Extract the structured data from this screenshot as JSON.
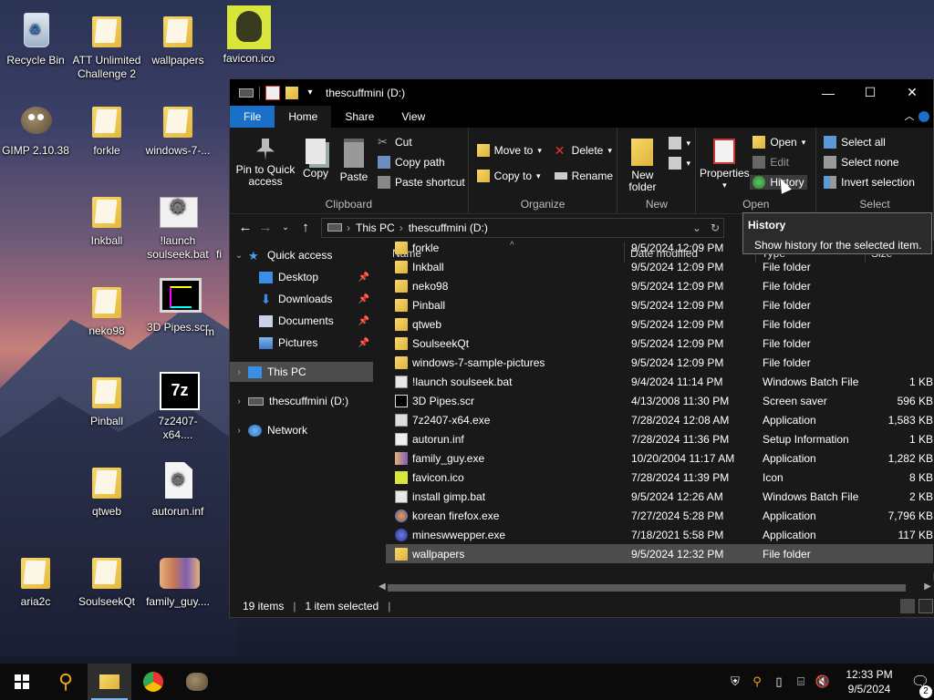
{
  "desktop": {
    "icons": [
      {
        "label": "Recycle Bin",
        "icon": "recycle-bin-icon"
      },
      {
        "label": "ATT Unlimited Challenge 2",
        "icon": "folder-icon"
      },
      {
        "label": "wallpapers",
        "icon": "folder-icon"
      },
      {
        "label": "favicon.ico",
        "icon": "image-icon"
      },
      {
        "label": "GIMP 2.10.38",
        "icon": "gimp-icon"
      },
      {
        "label": "forkle",
        "icon": "folder-icon"
      },
      {
        "label": "windows-7-...",
        "icon": "folder-icon"
      },
      {
        "label": "Inkball",
        "icon": "folder-icon"
      },
      {
        "label": "!launch soulseek.bat",
        "icon": "batch-file-icon"
      },
      {
        "label": "neko98",
        "icon": "folder-icon"
      },
      {
        "label": "3D Pipes.scr",
        "icon": "screensaver-icon"
      },
      {
        "label": "Pinball",
        "icon": "folder-icon"
      },
      {
        "label": "7z2407-x64....",
        "icon": "7zip-icon"
      },
      {
        "label": "qtweb",
        "icon": "folder-icon"
      },
      {
        "label": "autorun.inf",
        "icon": "inf-file-icon"
      },
      {
        "label": "aria2c",
        "icon": "folder-icon"
      },
      {
        "label": "SoulseekQt",
        "icon": "folder-icon"
      },
      {
        "label": "family_guy....",
        "icon": "app-icon"
      }
    ],
    "partial_labels": [
      "m",
      "fi"
    ]
  },
  "window": {
    "title": "thescuffmini (D:)",
    "controls": {
      "minimize": "—",
      "maximize": "☐",
      "close": "✕"
    },
    "tabs": [
      {
        "label": "File"
      },
      {
        "label": "Home"
      },
      {
        "label": "Share"
      },
      {
        "label": "View"
      }
    ],
    "ribbon": {
      "clipboard": {
        "label": "Clipboard",
        "pin": "Pin to Quick access",
        "copy": "Copy",
        "paste": "Paste",
        "cut": "Cut",
        "copy_path": "Copy path",
        "paste_shortcut": "Paste shortcut"
      },
      "organize": {
        "label": "Organize",
        "move_to": "Move to",
        "copy_to": "Copy to",
        "delete": "Delete",
        "rename": "Rename"
      },
      "new": {
        "label": "New",
        "new_folder": "New folder"
      },
      "open": {
        "label": "Open",
        "properties": "Properties",
        "open": "Open",
        "edit": "Edit",
        "history": "History"
      },
      "select": {
        "label": "Select",
        "select_all": "Select all",
        "select_none": "Select none",
        "invert": "Invert selection"
      }
    },
    "address": {
      "crumbs": [
        "This PC",
        "thescuffmini (D:)"
      ]
    },
    "nav_pane": [
      {
        "label": "Quick access",
        "icon": "star-icon",
        "chev": "⌄",
        "pinned": false
      },
      {
        "label": "Desktop",
        "icon": "desktop-icon",
        "chev": "",
        "pinned": true
      },
      {
        "label": "Downloads",
        "icon": "download-icon",
        "chev": "",
        "pinned": true
      },
      {
        "label": "Documents",
        "icon": "documents-icon",
        "chev": "",
        "pinned": true
      },
      {
        "label": "Pictures",
        "icon": "pictures-icon",
        "chev": "",
        "pinned": true
      },
      {
        "label": "This PC",
        "icon": "computer-icon",
        "chev": "›",
        "pinned": false
      },
      {
        "label": "thescuffmini (D:)",
        "icon": "drive-icon",
        "chev": "›",
        "pinned": false
      },
      {
        "label": "Network",
        "icon": "network-icon",
        "chev": "›",
        "pinned": false
      }
    ],
    "columns": {
      "name": "Name",
      "date": "Date modified",
      "type": "Type",
      "size": "Size"
    },
    "files": [
      {
        "name": "forkle",
        "date": "9/5/2024 12:09 PM",
        "type": "File folder",
        "size": "",
        "kind": "folder"
      },
      {
        "name": "Inkball",
        "date": "9/5/2024 12:09 PM",
        "type": "File folder",
        "size": "",
        "kind": "folder"
      },
      {
        "name": "neko98",
        "date": "9/5/2024 12:09 PM",
        "type": "File folder",
        "size": "",
        "kind": "folder"
      },
      {
        "name": "Pinball",
        "date": "9/5/2024 12:09 PM",
        "type": "File folder",
        "size": "",
        "kind": "folder"
      },
      {
        "name": "qtweb",
        "date": "9/5/2024 12:09 PM",
        "type": "File folder",
        "size": "",
        "kind": "folder"
      },
      {
        "name": "SoulseekQt",
        "date": "9/5/2024 12:09 PM",
        "type": "File folder",
        "size": "",
        "kind": "folder"
      },
      {
        "name": "windows-7-sample-pictures",
        "date": "9/5/2024 12:09 PM",
        "type": "File folder",
        "size": "",
        "kind": "folder"
      },
      {
        "name": "!launch soulseek.bat",
        "date": "9/4/2024 11:14 PM",
        "type": "Windows Batch File",
        "size": "1 KB",
        "kind": "bat"
      },
      {
        "name": "3D Pipes.scr",
        "date": "4/13/2008 11:30 PM",
        "type": "Screen saver",
        "size": "596 KB",
        "kind": "scr"
      },
      {
        "name": "7z2407-x64.exe",
        "date": "7/28/2024 12:08 AM",
        "type": "Application",
        "size": "1,583 KB",
        "kind": "exe"
      },
      {
        "name": "autorun.inf",
        "date": "7/28/2024 11:36 PM",
        "type": "Setup Information",
        "size": "1 KB",
        "kind": "inf"
      },
      {
        "name": "family_guy.exe",
        "date": "10/20/2004 11:17 AM",
        "type": "Application",
        "size": "1,282 KB",
        "kind": "family"
      },
      {
        "name": "favicon.ico",
        "date": "7/28/2024 11:39 PM",
        "type": "Icon",
        "size": "8 KB",
        "kind": "ico"
      },
      {
        "name": "install gimp.bat",
        "date": "9/5/2024 12:26 AM",
        "type": "Windows Batch File",
        "size": "2 KB",
        "kind": "bat"
      },
      {
        "name": "korean firefox.exe",
        "date": "7/27/2024 5:28 PM",
        "type": "Application",
        "size": "7,796 KB",
        "kind": "fox"
      },
      {
        "name": "mineswwepper.exe",
        "date": "7/18/2021 5:58 PM",
        "type": "Application",
        "size": "117 KB",
        "kind": "globe"
      },
      {
        "name": "wallpapers",
        "date": "9/5/2024 12:32 PM",
        "type": "File folder",
        "size": "",
        "kind": "folder",
        "selected": true
      }
    ],
    "status": {
      "items": "19 items",
      "selected": "1 item selected"
    },
    "tooltip": {
      "title": "History",
      "body": "Show history for the selected item."
    }
  },
  "taskbar": {
    "time": "12:33 PM",
    "date": "9/5/2024",
    "notifications": "2"
  }
}
